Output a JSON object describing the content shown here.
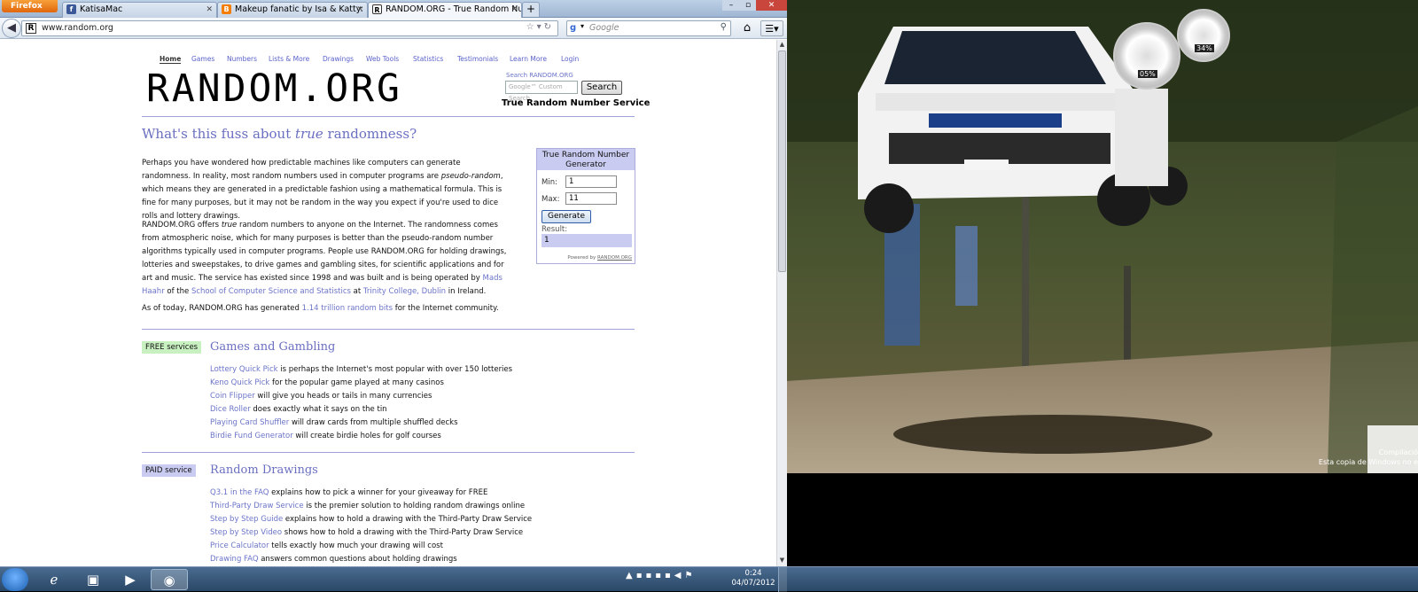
{
  "browser": {
    "menu_button": "Firefox",
    "tabs": [
      {
        "title": "KatisaMac",
        "icon": "facebook-icon",
        "color": "#3b5998",
        "glyph": "f"
      },
      {
        "title": "Makeup fanatic by Isa & Katty: 1º Sor...",
        "icon": "blogger-icon",
        "color": "#f57d00",
        "glyph": "B"
      },
      {
        "title": "RANDOM.ORG - True Random Num...",
        "icon": "random-org-icon",
        "color": "#333333",
        "glyph": "R"
      }
    ],
    "url": "www.random.org",
    "search_placeholder": "Google",
    "window_controls": [
      "–",
      "▫",
      "✕"
    ]
  },
  "page": {
    "nav": [
      "Home",
      "Games",
      "Numbers",
      "Lists & More",
      "Drawings",
      "Web Tools",
      "Statistics",
      "Testimonials",
      "Learn More",
      "Login"
    ],
    "logo": "RANDOM.ORG",
    "site_search": {
      "label": "Search RANDOM.ORG",
      "placeholder": "Google™ Custom Search",
      "button": "Search"
    },
    "tagline": "True Random Number Service",
    "heading_pre": "What's this fuss about ",
    "heading_em": "true",
    "heading_post": " randomness?",
    "intro": {
      "p1a": "Perhaps you have wondered how predictable machines like computers can generate randomness. In reality, most random numbers used in computer programs are ",
      "p1em": "pseudo-random",
      "p1b": ", which means they are generated in a predictable fashion using a mathematical formula. This is fine for many purposes, but it may not be random in the way you expect if you're used to dice rolls and lottery drawings.",
      "p2a": "RANDOM.ORG offers ",
      "p2em": "true",
      "p2b": " random numbers to anyone on the Internet. The randomness comes from atmospheric noise, which for many purposes is better than the pseudo-random number algorithms typically used in computer programs. People use RANDOM.ORG for holding drawings, lotteries and sweepstakes, to drive games and gambling sites, for scientific applications and for art and music. The service has existed since 1998 and was built and is being operated by ",
      "p2link1": "Mads Haahr",
      "p2c": " of the ",
      "p2link2": "School of Computer Science and Statistics",
      "p2d": " at ",
      "p2link3": "Trinity College, Dublin",
      "p2e": " in Ireland.",
      "p3a": "As of today, RANDOM.ORG has generated ",
      "p3link": "1.14 trillion random bits",
      "p3b": " for the Internet community."
    },
    "widget": {
      "title": "True Random Number Generator",
      "min_label": "Min:",
      "min_value": "1",
      "max_label": "Max:",
      "max_value": "11",
      "button": "Generate",
      "result_label": "Result:",
      "result_value": "1",
      "powered_pre": "Powered by ",
      "powered_link": "RANDOM.ORG"
    },
    "games": {
      "badge": "FREE services",
      "badge_color": "#c9f0c1",
      "title": "Games and Gambling",
      "items": [
        {
          "link": "Lottery Quick Pick",
          "text": " is perhaps the Internet's most popular with over 150 lotteries"
        },
        {
          "link": "Keno Quick Pick",
          "text": " for the popular game played at many casinos"
        },
        {
          "link": "Coin Flipper",
          "text": " will give you heads or tails in many currencies"
        },
        {
          "link": "Dice Roller",
          "text": " does exactly what it says on the tin"
        },
        {
          "link": "Playing Card Shuffler",
          "text": " will draw cards from multiple shuffled decks"
        },
        {
          "link": "Birdie Fund Generator",
          "text": " will create birdie holes for golf courses"
        }
      ]
    },
    "drawings": {
      "badge": "PAID service",
      "badge_color": "#c9cbf0",
      "title": "Random Drawings",
      "items": [
        {
          "link": "Q3.1 in the FAQ",
          "text": " explains how to pick a winner for your giveaway for FREE"
        },
        {
          "link": "Third-Party Draw Service",
          "text": " is the premier solution to holding random drawings online"
        },
        {
          "link": "Step by Step Guide",
          "text": " explains how to hold a drawing with the Third-Party Draw Service"
        },
        {
          "link": "Step by Step Video",
          "text": " shows how to hold a drawing with the Third-Party Draw Service"
        },
        {
          "link": "Price Calculator",
          "text": " tells exactly how much your drawing will cost"
        },
        {
          "link": "Drawing FAQ",
          "text": " answers common questions about holding drawings"
        }
      ]
    }
  },
  "desktop": {
    "gauge_left": "05%",
    "gauge_right": "34%",
    "watermark_line1": "Compilació",
    "watermark_line2": "Esta copia de Windows no e"
  },
  "taskbar": {
    "time": "0:24",
    "date": "04/07/2012",
    "apps": [
      "windows-explorer-icon",
      "internet-explorer-icon",
      "media-player-icon",
      "firefox-icon"
    ]
  }
}
